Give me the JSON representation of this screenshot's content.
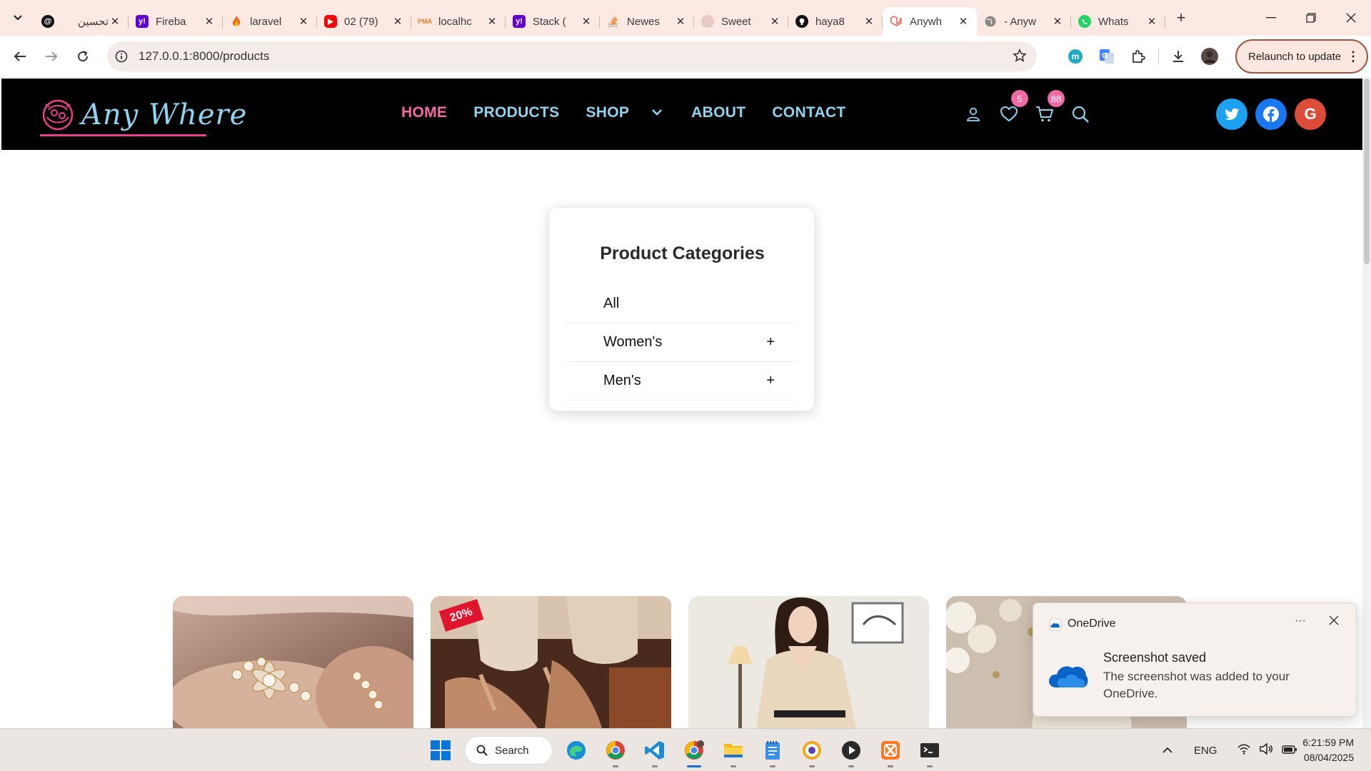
{
  "browser": {
    "tabs": [
      {
        "title": "تحسين",
        "icon": "threads-icon",
        "active": false
      },
      {
        "title": "Fireba",
        "icon": "yahoo-icon",
        "active": false
      },
      {
        "title": "laravel",
        "icon": "fire-icon",
        "active": false
      },
      {
        "title": "02 (79)",
        "icon": "youtube-icon",
        "active": false
      },
      {
        "title": "localhc",
        "icon": "phpmyadmin-icon",
        "active": false
      },
      {
        "title": "Stack (",
        "icon": "yahoo-icon",
        "active": false
      },
      {
        "title": "Newes",
        "icon": "stackoverflow-icon",
        "active": false
      },
      {
        "title": "Sweet",
        "icon": "sweetalert-icon",
        "active": false
      },
      {
        "title": "haya8",
        "icon": "github-icon",
        "active": false
      },
      {
        "title": "Anywh",
        "icon": "laravel-icon",
        "active": true
      },
      {
        "title": "- Anyw",
        "icon": "globe-icon",
        "active": false
      },
      {
        "title": "Whats",
        "icon": "whatsapp-icon",
        "active": false
      }
    ],
    "url": "127.0.0.1:8000/products",
    "relaunch_label": "Relaunch to update"
  },
  "site": {
    "logo_text": "Any Where",
    "nav": {
      "home": "HOME",
      "products": "PRODUCTS",
      "shop": "SHOP",
      "about": "ABOUT",
      "contact": "CONTACT"
    },
    "wishlist_count": "5",
    "cart_count": "88",
    "social": {
      "twitter": "twitter-icon",
      "facebook": "facebook-icon",
      "google": "G"
    }
  },
  "categories": {
    "title": "Product Categories",
    "items": [
      {
        "label": "All",
        "expandable": false
      },
      {
        "label": "Women's",
        "expandable": true,
        "toggle": "+"
      },
      {
        "label": "Men's",
        "expandable": true,
        "toggle": "+"
      }
    ]
  },
  "products": [
    {
      "image": "pearl-bracelet",
      "badge": ""
    },
    {
      "image": "heeled-sandals",
      "badge": "20%"
    },
    {
      "image": "woman-in-beige-dress",
      "badge": ""
    },
    {
      "image": "handbag-with-roses",
      "badge": ""
    }
  ],
  "toast": {
    "app": "OneDrive",
    "more": "···",
    "title": "Screenshot saved",
    "body": "The screenshot was added to your OneDrive."
  },
  "taskbar": {
    "search_label": "Search",
    "language": "ENG",
    "time": "6:21:59 PM",
    "date": "08/04/2025"
  },
  "colors": {
    "accent_pink": "#f26aa5",
    "nav_blue": "#8fd3ef",
    "header_bg": "#000000",
    "tabstrip_bg": "#fde9e4"
  }
}
